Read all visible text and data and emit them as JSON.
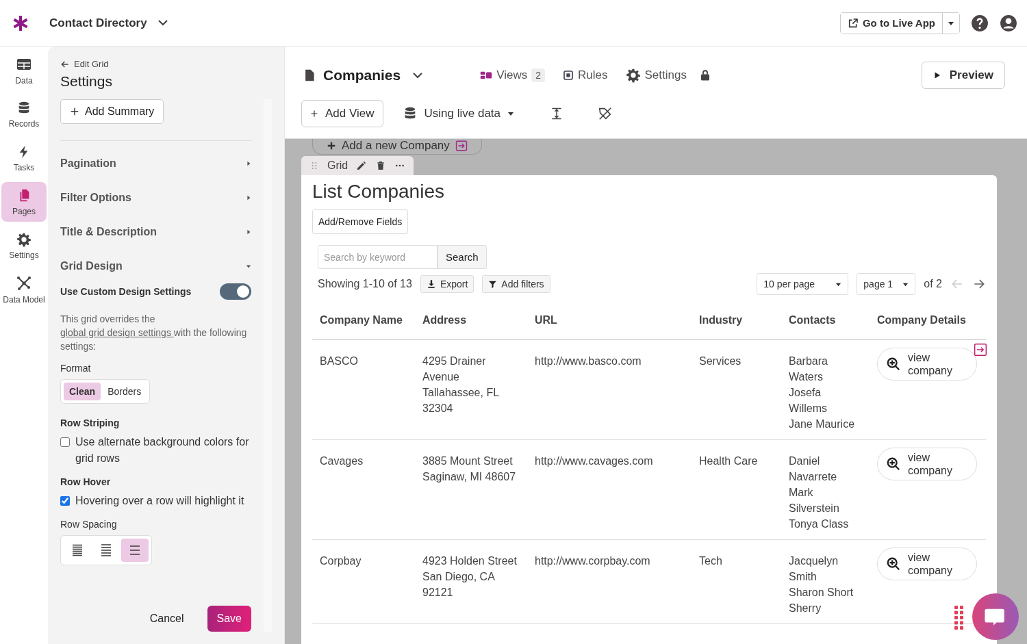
{
  "app": {
    "title": "Contact Directory",
    "live_app": "Go to Live App"
  },
  "nav": [
    {
      "label": "Data",
      "kind": "table",
      "selected": false
    },
    {
      "label": "Records",
      "kind": "database",
      "selected": false
    },
    {
      "label": "Tasks",
      "kind": "bolt",
      "selected": false
    },
    {
      "label": "Pages",
      "kind": "pages",
      "selected": true
    },
    {
      "label": "Settings",
      "kind": "gear",
      "selected": false
    },
    {
      "label": "Data Model",
      "kind": "graph",
      "selected": false
    }
  ],
  "panel": {
    "back": "Edit Grid",
    "title": "Settings",
    "add_summary": "Add Summary",
    "sections": [
      {
        "label": "Pagination",
        "expanded": false
      },
      {
        "label": "Filter Options",
        "expanded": false
      },
      {
        "label": "Title & Description",
        "expanded": false
      },
      {
        "label": "Grid Design",
        "expanded": true
      }
    ],
    "custom_design": {
      "label": "Use Custom Design Settings",
      "on": true
    },
    "note": {
      "before": "This grid overrides the ",
      "link": "global grid design settings ",
      "after": "with the following settings:"
    },
    "format": {
      "label": "Format",
      "options": [
        {
          "label": "Clean",
          "selected": true
        },
        {
          "label": "Borders",
          "selected": false
        }
      ]
    },
    "striping": {
      "label": "Row Striping",
      "text": "Use alternate background colors for grid rows",
      "checked": false
    },
    "hover": {
      "label": "Row Hover",
      "text": "Hovering over a row will highlight it",
      "checked": true
    },
    "spacing": {
      "label": "Row Spacing",
      "options": [
        {
          "kind": "compact",
          "selected": false
        },
        {
          "kind": "normal",
          "selected": false
        },
        {
          "kind": "wide",
          "selected": true
        }
      ]
    },
    "cancel": "Cancel",
    "save": "Save"
  },
  "page": {
    "title": "Companies",
    "tabs": [
      {
        "label": "Views",
        "count": "2",
        "kind": "views"
      },
      {
        "label": "Rules",
        "kind": "chip"
      },
      {
        "label": "Settings",
        "kind": "gear"
      }
    ],
    "preview": "Preview",
    "add_view": "Add View",
    "data_source": "Using live data"
  },
  "canvas": {
    "add_record": "Add a new Company",
    "element": "Grid",
    "grid": {
      "title": "List Companies",
      "fields_button": "Add/Remove Fields",
      "search": {
        "placeholder": "Search by keyword",
        "button": "Search"
      },
      "summary": "Showing 1-10 of 13",
      "export": "Export",
      "filters": "Add filters",
      "per_page": "10 per page",
      "page": "page 1",
      "of": "of 2",
      "columns": [
        "Company Name",
        "Address",
        "URL",
        "Industry",
        "Contacts",
        "Company Details"
      ],
      "rows": [
        {
          "company": "BASCO",
          "address": [
            "4295 Drainer Avenue",
            "Tallahassee, FL 32304"
          ],
          "url": "http://www.basco.com",
          "industry": "Services",
          "contacts": [
            "Barbara Waters",
            "Josefa Willems",
            "Jane Maurice"
          ],
          "action": "view company"
        },
        {
          "company": "Cavages",
          "address": [
            "3885 Mount Street",
            "Saginaw, MI 48607"
          ],
          "url": "http://www.cavages.com",
          "industry": "Health Care",
          "contacts": [
            "Daniel Navarrete",
            "Mark Silverstein",
            "Tonya Class"
          ],
          "action": "view company"
        },
        {
          "company": "Corpbay",
          "address": [
            "4923 Holden Street",
            "San Diego, CA 92121"
          ],
          "url": "http://www.corpbay.com",
          "industry": "Tech",
          "contacts": [
            "Jacquelyn Smith",
            "Sharon Short",
            "Sherry"
          ],
          "action": "view company"
        }
      ]
    }
  }
}
